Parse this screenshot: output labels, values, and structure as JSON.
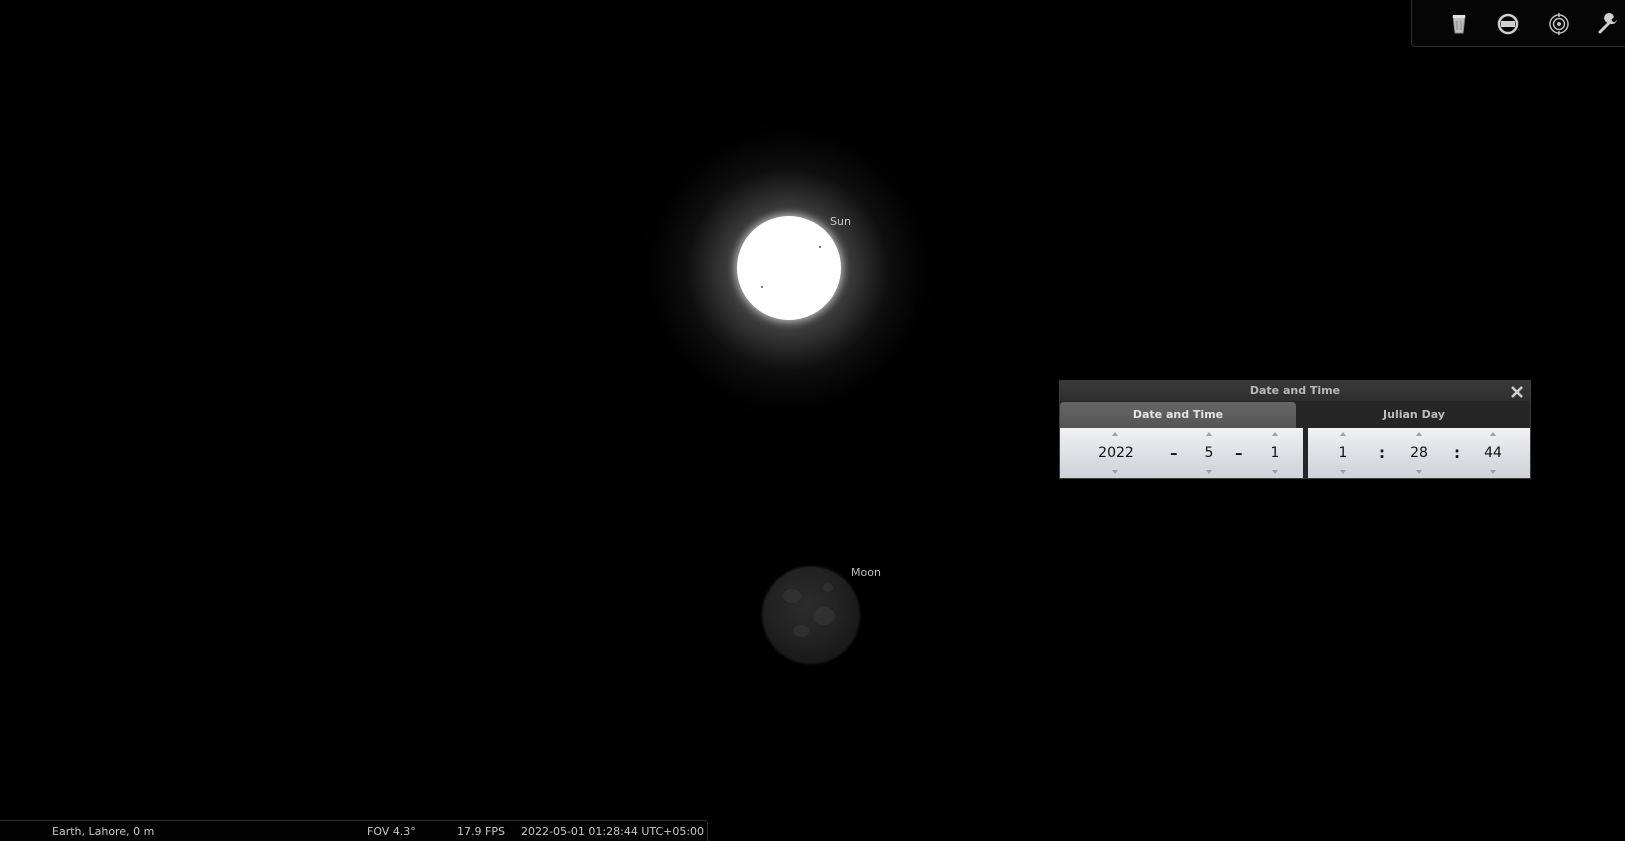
{
  "sky": {
    "sun_label": "Sun",
    "moon_label": "Moon"
  },
  "toolbar": {
    "buttons": [
      {
        "name": "telescope-icon"
      },
      {
        "name": "ocular-view-icon"
      },
      {
        "name": "sensor-frame-icon"
      },
      {
        "name": "wrench-icon"
      }
    ]
  },
  "dialog": {
    "title": "Date and Time",
    "tabs": [
      "Date and Time",
      "Julian Day"
    ],
    "date": {
      "year": "2022",
      "month": "5",
      "day": "1",
      "sep": "–"
    },
    "time": {
      "hour": "1",
      "minute": "28",
      "second": "44",
      "sep": ":"
    }
  },
  "status_bar": {
    "location": "Earth, Lahore, 0 m",
    "fov": "FOV 4.3°",
    "fps": "17.9 FPS",
    "datetime": "2022-05-01 01:28:44 UTC+05:00"
  },
  "colors": {
    "background": "#000000",
    "panel": "#262626",
    "label": "#c8c8c8"
  }
}
